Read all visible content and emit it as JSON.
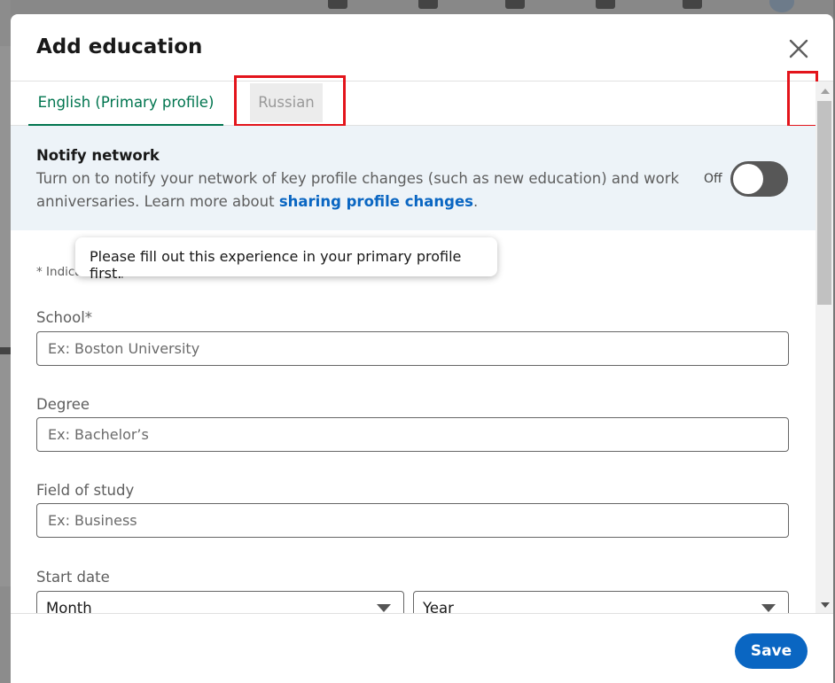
{
  "modal": {
    "title": "Add education"
  },
  "tabs": {
    "primary": "English (Primary profile)",
    "secondary": "Russian"
  },
  "tooltip": {
    "text": "Please fill out this experience in your primary profile first."
  },
  "notify": {
    "title": "Notify network",
    "text_before": "Turn on to notify your network of key profile changes (such as new education) and work anniversaries. Learn more about ",
    "link": "sharing profile changes",
    "text_after": ".",
    "toggle_label": "Off",
    "toggle_on": false
  },
  "form": {
    "required_note": "* Indicates required",
    "school_label": "School*",
    "school_placeholder": "Ex: Boston University",
    "degree_label": "Degree",
    "degree_placeholder": "Ex: Bachelor’s",
    "field_label": "Field of study",
    "field_placeholder": "Ex: Business",
    "start_date_label": "Start date",
    "month_value": "Month",
    "year_value": "Year"
  },
  "footer": {
    "save_label": "Save"
  },
  "colors": {
    "accent_green": "#01754f",
    "primary_blue": "#0a66c2",
    "highlight_red": "#e3141b",
    "banner_bg": "#edf3f8"
  }
}
